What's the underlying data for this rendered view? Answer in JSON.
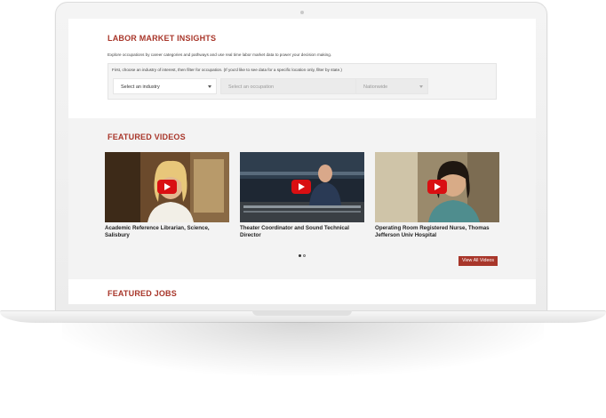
{
  "labor_market": {
    "title": "LABOR MARKET INSIGHTS",
    "description": "Explore occupations by career categories and pathways and use real time labor market data to power your decision making.",
    "filter_hint": "First, choose an industry of interest, then filter for occupation. (If you'd like to see data for a specific location only, filter by state.)",
    "industry_select": "Select an industry",
    "occupation_select": "Select an occupation",
    "location_select": "Nationwide"
  },
  "featured_videos": {
    "title": "FEATURED VIDEOS",
    "videos": [
      {
        "title": "Academic Reference Librarian, Science, Salisbury",
        "icon": "play-icon"
      },
      {
        "title": "Theater Coordinator and Sound Technical Director",
        "icon": "play-icon"
      },
      {
        "title": "Operating Room Registered Nurse, Thomas Jefferson Univ Hospital",
        "icon": "play-icon"
      }
    ],
    "carousel_pages": 2,
    "active_page": 1,
    "view_all_label": "View All Videos"
  },
  "featured_jobs": {
    "title": "FEATURED JOBS"
  },
  "colors": {
    "accent": "#a8362a",
    "play": "#d90f12"
  }
}
